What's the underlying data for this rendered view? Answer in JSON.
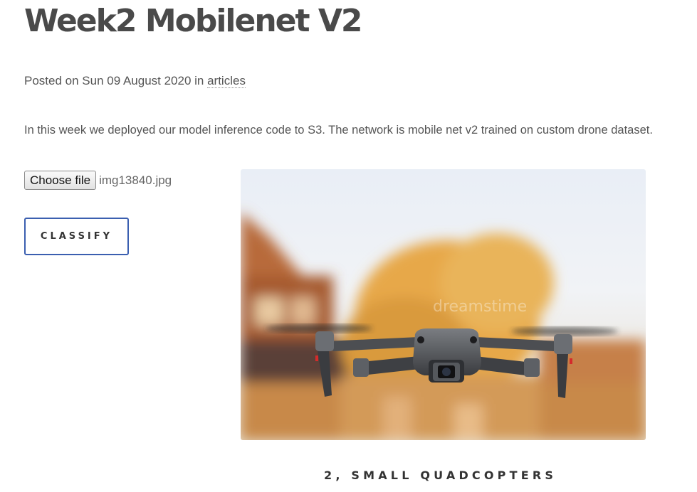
{
  "post": {
    "title": "Week2 Mobilenet V2",
    "posted_prefix": "Posted on Sun 09 August 2020 in ",
    "category": "articles",
    "intro": "In this week we deployed our model inference code to S3. The network is mobile net v2 trained on custom drone dataset."
  },
  "upload": {
    "choose_label": "Choose file",
    "file_name": "img13840.jpg"
  },
  "classify": {
    "label": "CLASSIFY"
  },
  "preview": {
    "subject": "drone-photo"
  },
  "result": {
    "text": "2, SMALL QUADCOPTERS"
  }
}
